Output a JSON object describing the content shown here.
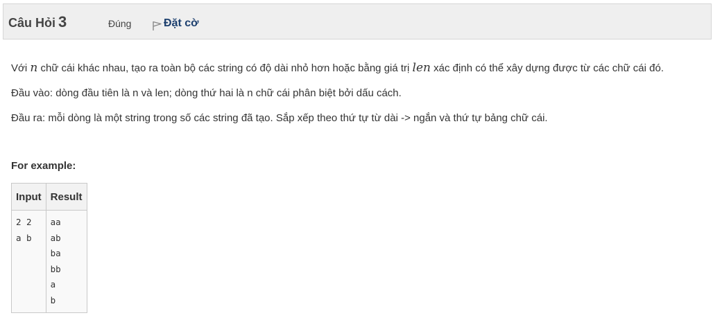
{
  "question": {
    "title_label": "Câu Hỏi",
    "number": "3",
    "state": "Đúng",
    "flag_label": "Đặt cờ"
  },
  "body": {
    "line1_prefix": "Với",
    "line1_var_n": "n",
    "line1_middle": "chữ cái khác nhau, tạo ra toàn bộ các string có độ dài nhỏ hơn hoặc bằng giá trị",
    "line1_var_len": "len",
    "line1_suffix": "xác định có thể xây dựng được từ các chữ cái đó.",
    "input_desc": "Đầu vào: dòng đầu tiên là n và len; dòng thứ hai là n chữ cái phân biệt bởi dấu cách.",
    "output_desc": "Đầu ra: mỗi dòng là một string trong số các string đã tạo. Sắp xếp theo thứ tự từ dài -> ngắn và thứ tự bảng chữ cái."
  },
  "example": {
    "heading": "For example:",
    "headers": [
      "Input",
      "Result"
    ],
    "rows": [
      {
        "input": "2 2\na b",
        "result": "aa\nab\nba\nbb\na\nb"
      }
    ]
  }
}
